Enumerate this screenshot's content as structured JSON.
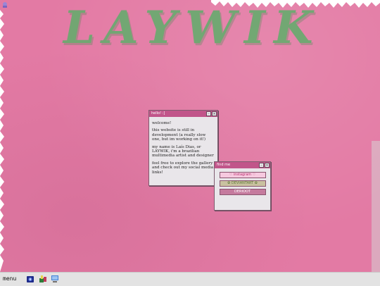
{
  "desktop": {
    "logo_text": "LAYWIK",
    "background_color": "#e37aa4"
  },
  "window_hello": {
    "title": "hello! :]",
    "paragraphs": [
      "welcome!",
      "this website is still in development (a really slow one, but im working on it!)",
      "my name is Laís Dias, or LAYWIK, i'm a brazilian multimedia artist and designer",
      "feel free to explore the gallery and check out my social media links!"
    ]
  },
  "window_find": {
    "title": "find me",
    "links": [
      "♡ instagram ♡",
      "✿ DEVIANTART ✿",
      "DERIOOT"
    ]
  },
  "taskbar": {
    "menu_label": "menu",
    "icons": [
      "camera-icon",
      "paint-icon",
      "computer-icon"
    ]
  },
  "colors": {
    "accent": "#c1558a",
    "logo_green": "#5fae6a"
  }
}
